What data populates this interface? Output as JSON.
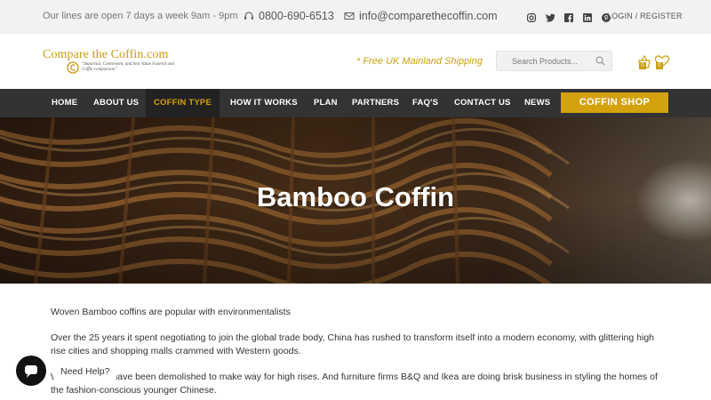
{
  "topbar": {
    "hours": "Our lines are open 7 days a week 9am - 9pm",
    "phone": "0800-690-6513",
    "email": "info@comparethecoffin.com",
    "social_icons": [
      "instagram-icon",
      "twitter-icon",
      "facebook-icon",
      "linkedin-icon",
      "pinterest-icon"
    ],
    "login_register": "LOGIN / REGISTER"
  },
  "header": {
    "logo_title": "Compare the Coffin.com",
    "logo_tagline": "\"Impartial, Convenient, and best Value Funeral and Coffin comparison\"",
    "shipping": "* Free UK Mainland Shipping",
    "search_placeholder": "Search Products...",
    "cart_count": "0",
    "wishlist_count": "0"
  },
  "nav": {
    "items": [
      {
        "label": "HOME"
      },
      {
        "label": "ABOUT US"
      },
      {
        "label": "COFFIN TYPE"
      },
      {
        "label": "HOW IT WORKS"
      },
      {
        "label": "PLAN"
      },
      {
        "label": "PARTNERS"
      },
      {
        "label": "FAQ'S"
      },
      {
        "label": "CONTACT US"
      },
      {
        "label": "NEWS"
      }
    ],
    "active": "COFFIN TYPE",
    "shop_button": "COFFIN SHOP"
  },
  "hero": {
    "title": "Bamboo Coffin"
  },
  "content": {
    "paragraphs": [
      "Woven Bamboo coffins are popular with environmentalists",
      "Over the 25 years it spent negotiating to join the global trade body, China has rushed to transform itself into a modern economy, with glittering high rise cities and shopping malls crammed with Western goods.",
      "Whole houses have been demolished to make way for high rises. And furniture firms B&Q and Ikea are doing brisk business in styling the homes of the fashion-conscious younger Chinese."
    ]
  },
  "chat": {
    "need_help": "Need Help?"
  },
  "colors": {
    "accent_gold": "#d4a20f",
    "nav_bg": "#333333",
    "nav_active_bg": "#222222",
    "topbar_bg": "#f2f2f2"
  }
}
